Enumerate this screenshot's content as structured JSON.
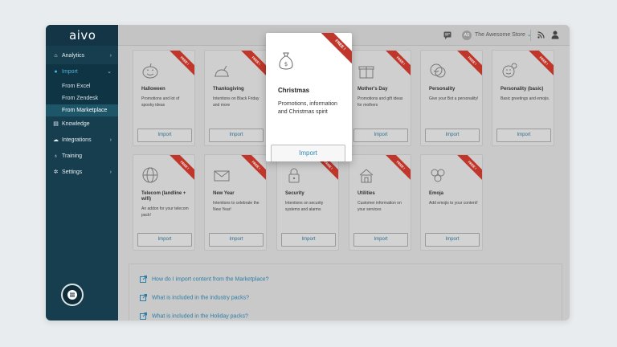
{
  "app": {
    "logo": "aivo",
    "store_initials": "AS",
    "store_name": "The Awesome Store"
  },
  "sidebar": {
    "items": [
      {
        "label": "Analytics"
      },
      {
        "label": "Import",
        "sub": [
          "From Excel",
          "From Zendesk",
          "From Marketplace"
        ]
      },
      {
        "label": "Knowledge"
      },
      {
        "label": "Integrations"
      },
      {
        "label": "Training"
      },
      {
        "label": "Settings"
      }
    ]
  },
  "ribbon_text": "FREE !",
  "cards": [
    {
      "title": "Halloween",
      "desc": "Promotions and lot of spooky ideas",
      "button": "Import",
      "icon": "pumpkin-icon"
    },
    {
      "title": "Thanksgiving",
      "desc": "Intentions on Black Friday and more",
      "button": "Import",
      "icon": "turkey-icon"
    },
    {
      "title": "Christmas",
      "desc": "Promotions, information and Christmas spirit",
      "button": "Import",
      "icon": "money-bag-icon"
    },
    {
      "title": "Mother's Day",
      "desc": "Promotions and gift ideas for mothers",
      "button": "Import",
      "icon": "gift-icon"
    },
    {
      "title": "Personality",
      "desc": "Give your Bot a personality!",
      "button": "Import",
      "icon": "theater-masks-icon"
    },
    {
      "title": "Personality (basic)",
      "desc": "Basic greetings and emojis.",
      "button": "Import",
      "icon": "smiley-icon"
    },
    {
      "title": "Telecom (landline + wifi)",
      "desc": "An addon for your telecom pack!",
      "button": "Import",
      "icon": "globe-icon"
    },
    {
      "title": "New Year",
      "desc": "Intentions to celebrate the New Year!",
      "button": "Import",
      "icon": "envelope-icon"
    },
    {
      "title": "Security",
      "desc": "Intentions on security systems and alarms",
      "button": "Import",
      "icon": "padlock-icon"
    },
    {
      "title": "Utilities",
      "desc": "Customer information on your services",
      "button": "Import",
      "icon": "house-icon"
    },
    {
      "title": "Emoja",
      "desc": "Add emojis to your content!",
      "button": "Import",
      "icon": "emoji-cluster-icon"
    }
  ],
  "faq": [
    "How do I import content from the Marketplace?",
    "What is included in the industry packs?",
    "What is included in the Holiday packs?"
  ],
  "colors": {
    "sidebar": "#163e4f",
    "accent": "#4fb3d9",
    "ribbon": "#c0362b",
    "link": "#2e7ea6"
  }
}
